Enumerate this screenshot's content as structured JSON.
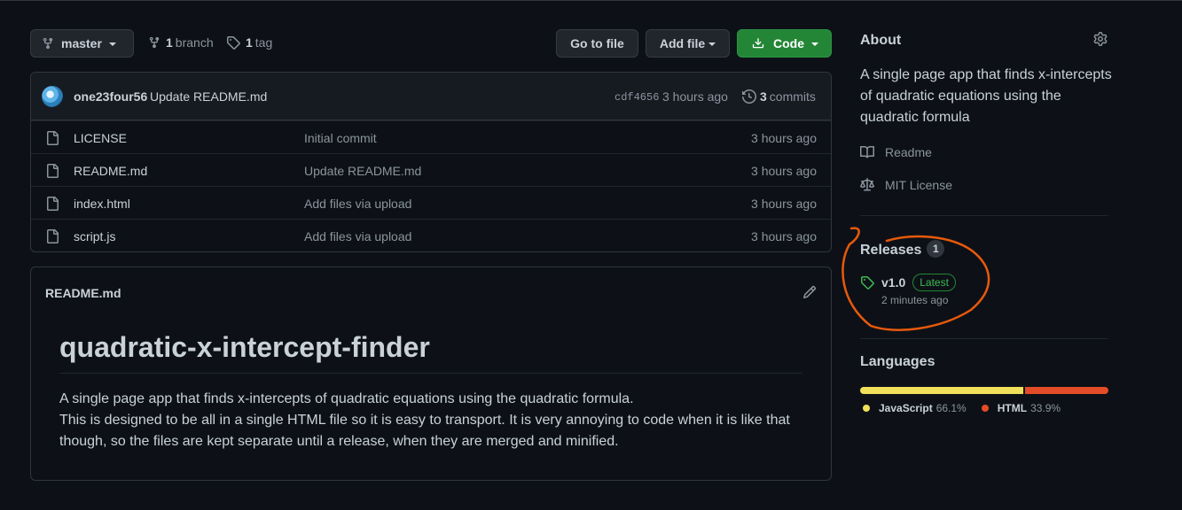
{
  "toolbar": {
    "branch_select": "master",
    "branches_count": "1",
    "branches_label": "branch",
    "tags_count": "1",
    "tags_label": "tag",
    "go_to_file": "Go to file",
    "add_file": "Add file",
    "code": "Code"
  },
  "latest_commit": {
    "author": "one23four56",
    "message": "Update README.md",
    "sha": "cdf4656",
    "time": "3 hours ago",
    "commits_count": "3",
    "commits_label": "commits"
  },
  "files": [
    {
      "name": "LICENSE",
      "commit": "Initial commit",
      "time": "3 hours ago"
    },
    {
      "name": "README.md",
      "commit": "Update README.md",
      "time": "3 hours ago"
    },
    {
      "name": "index.html",
      "commit": "Add files via upload",
      "time": "3 hours ago"
    },
    {
      "name": "script.js",
      "commit": "Add files via upload",
      "time": "3 hours ago"
    }
  ],
  "readme": {
    "label": "README.md",
    "heading": "quadratic-x-intercept-finder",
    "line1": "A single page app that finds x-intercepts of quadratic equations using the quadratic formula.",
    "line2": "This is designed to be all in a single HTML file so it is easy to transport. It is very annoying to code when it is like that though, so the files are kept separate until a release, when they are merged and minified."
  },
  "sidebar": {
    "about_title": "About",
    "about_description": "A single page app that finds x-intercepts of quadratic equations using the quadratic formula",
    "readme_link": "Readme",
    "license_link": "MIT License",
    "releases_title": "Releases",
    "releases_count": "1",
    "release_name": "v1.0",
    "release_badge": "Latest",
    "release_time": "2 minutes ago",
    "languages_title": "Languages",
    "languages": [
      {
        "name": "JavaScript",
        "percent": "66.1%",
        "value": 66.1,
        "color": "#f1e05a"
      },
      {
        "name": "HTML",
        "percent": "33.9%",
        "value": 33.9,
        "color": "#e34c26"
      }
    ]
  },
  "colors": {
    "background": "#0d1117",
    "border": "#30363d",
    "green_button": "#238636",
    "annotation_stroke": "#e8590c"
  }
}
